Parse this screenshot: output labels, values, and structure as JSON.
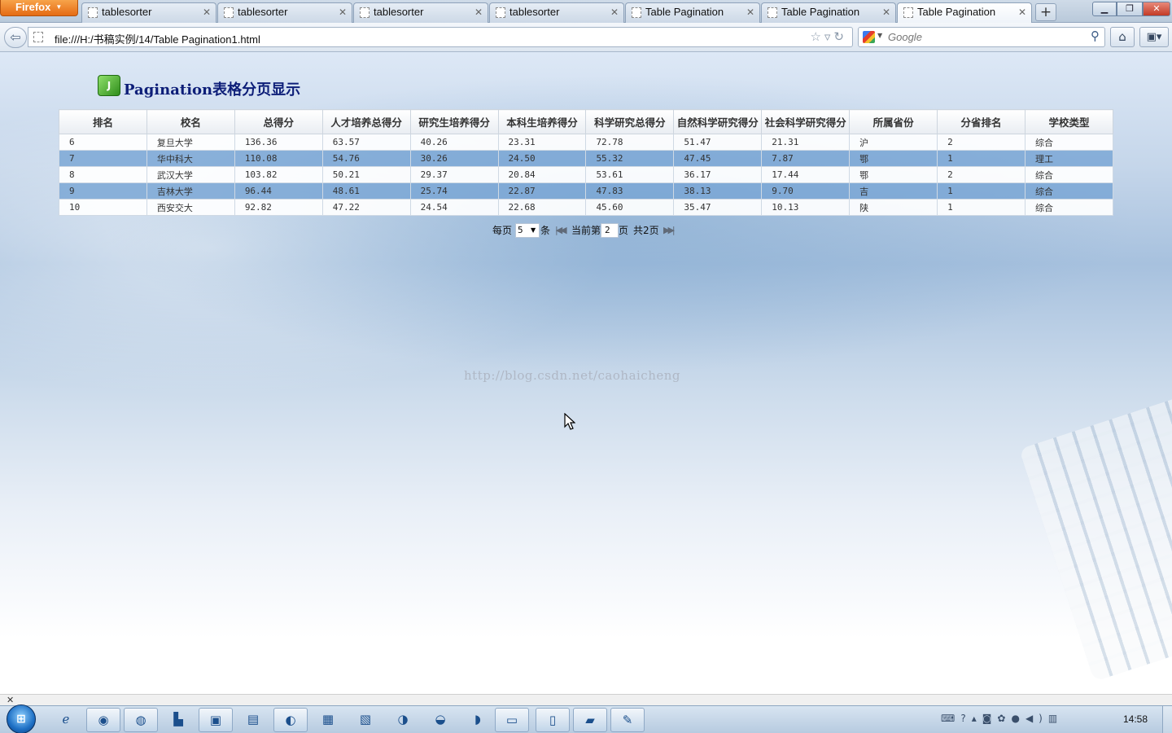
{
  "browser": {
    "menu_label": "Firefox",
    "tabs": [
      {
        "title": "tablesorter"
      },
      {
        "title": "tablesorter"
      },
      {
        "title": "tablesorter"
      },
      {
        "title": "tablesorter"
      },
      {
        "title": "Table Pagination"
      },
      {
        "title": "Table Pagination"
      },
      {
        "title": "Table Pagination"
      }
    ],
    "active_tab_index": 6,
    "url": "file:///H:/书稿实例/14/Table Pagination1.html",
    "search_placeholder": "Google"
  },
  "page": {
    "title": "Pagination表格分页显示",
    "logo_letter": "J",
    "table": {
      "headers": [
        "排名",
        "校名",
        "总得分",
        "人才培养总得分",
        "研究生培养得分",
        "本科生培养得分",
        "科学研究总得分",
        "自然科学研究得分",
        "社会科学研究得分",
        "所属省份",
        "分省排名",
        "学校类型"
      ],
      "rows": [
        [
          "6",
          "复旦大学",
          "136.36",
          "63.57",
          "40.26",
          "23.31",
          "72.78",
          "51.47",
          "21.31",
          "沪",
          "2",
          "综合"
        ],
        [
          "7",
          "华中科大",
          "110.08",
          "54.76",
          "30.26",
          "24.50",
          "55.32",
          "47.45",
          "7.87",
          "鄂",
          "1",
          "理工"
        ],
        [
          "8",
          "武汉大学",
          "103.82",
          "50.21",
          "29.37",
          "20.84",
          "53.61",
          "36.17",
          "17.44",
          "鄂",
          "2",
          "综合"
        ],
        [
          "9",
          "吉林大学",
          "96.44",
          "48.61",
          "25.74",
          "22.87",
          "47.83",
          "38.13",
          "9.70",
          "吉",
          "1",
          "综合"
        ],
        [
          "10",
          "西安交大",
          "92.82",
          "47.22",
          "24.54",
          "22.68",
          "45.60",
          "35.47",
          "10.13",
          "陕",
          "1",
          "综合"
        ]
      ]
    },
    "pager": {
      "per_page_label": "每页",
      "per_page_value": "5",
      "unit_label": "条",
      "current_label": "当前第",
      "current_page": "2",
      "page_label": "页",
      "total_label": "共2页"
    },
    "watermark": "http://blog.csdn.net/caohaicheng"
  },
  "taskbar": {
    "clock": "14:58"
  },
  "colors": {
    "title": "#0d1e78",
    "row_odd": "#ffffff",
    "row_even": "#74a3d4",
    "firefox_button": "#e56b14"
  }
}
